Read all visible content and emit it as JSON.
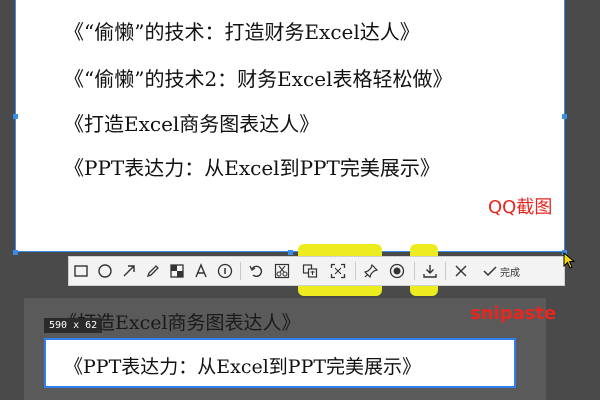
{
  "capture_lines": [
    "《“偷懒”的技术：打造财务Excel达人》",
    "《“偷懒”的技术2：财务Excel表格轻松做》",
    "《打造Excel商务图表达人》",
    "《PPT表达力：从Excel到PPT完美展示》"
  ],
  "qq_label": "QQ截图",
  "toolbar": {
    "confirm_label": "完成"
  },
  "snipaste": {
    "label": "snipaste",
    "size_badge": "590 x 62",
    "line_top": "《打造Excel商务图表达人》",
    "line_selected": "《PPT表达力：从Excel到PPT完美展示》"
  },
  "colors": {
    "accent_red": "#e8261f",
    "selection_blue": "#3b8ee8",
    "highlight_yellow": "#ecec1e"
  }
}
